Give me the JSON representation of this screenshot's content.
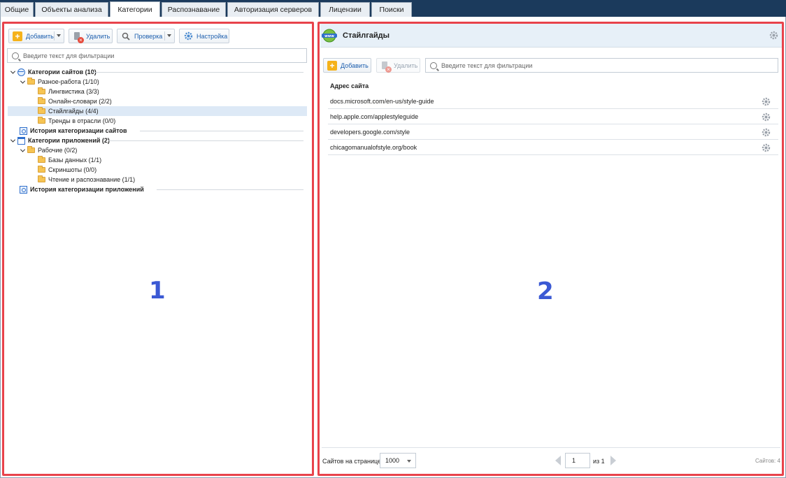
{
  "tabs": [
    {
      "label": "Общие",
      "active": false
    },
    {
      "label": "Объекты анализа",
      "active": false
    },
    {
      "label": "Категории",
      "active": true
    },
    {
      "label": "Распознавание",
      "active": false
    },
    {
      "label": "Авторизация серверов",
      "active": false
    },
    {
      "label": "Лицензии",
      "active": false
    },
    {
      "label": "Поиски",
      "active": false
    }
  ],
  "left_panel": {
    "toolbar": {
      "add": "Добавить",
      "delete": "Удалить",
      "check": "Проверка",
      "settings": "Настройка"
    },
    "filter_placeholder": "Введите текст для фильтрации",
    "tree": [
      {
        "label": "Категории сайтов (10)",
        "bold": true,
        "icon": "globe-icon"
      },
      {
        "label": "Разное-работа (1/10)",
        "bold": false,
        "icon": "folder-icon"
      },
      {
        "label": "Лингвистика (3/3)",
        "bold": false,
        "icon": "folder-icon"
      },
      {
        "label": "Онлайн-словари (2/2)",
        "bold": false,
        "icon": "folder-icon"
      },
      {
        "label": "Стайлгайды (4/4)",
        "bold": false,
        "icon": "folder-icon",
        "selected": true
      },
      {
        "label": "Тренды в отрасли (0/0)",
        "bold": false,
        "icon": "folder-icon"
      },
      {
        "label": "История категоризации сайтов",
        "bold": true,
        "icon": "history-icon"
      },
      {
        "label": "Категории приложений (2)",
        "bold": true,
        "icon": "app-icon"
      },
      {
        "label": "Рабочие (0/2)",
        "bold": false,
        "icon": "folder-icon"
      },
      {
        "label": "Базы данных (1/1)",
        "bold": false,
        "icon": "folder-icon"
      },
      {
        "label": "Скриншоты (0/0)",
        "bold": false,
        "icon": "folder-icon"
      },
      {
        "label": "Чтение и распознавание (1/1)",
        "bold": false,
        "icon": "folder-icon"
      },
      {
        "label": "История категоризации приложений",
        "bold": true,
        "icon": "history-icon"
      }
    ]
  },
  "right_panel": {
    "title": "Стайлгайды",
    "toolbar": {
      "add": "Добавить",
      "delete": "Удалить"
    },
    "filter_placeholder": "Введите текст для фильтрации",
    "column_header": "Адрес сайта",
    "urls": [
      "docs.microsoft.com/en-us/style-guide",
      "help.apple.com/applestyleguide",
      "developers.google.com/style",
      "chicagomanualofstyle.org/book"
    ],
    "footer": {
      "per_page_label": "Сайтов на странице",
      "per_page_value": "1000",
      "page_value": "1",
      "of_pages": "из 1",
      "total": "Сайтов: 4"
    }
  },
  "annotations": {
    "left": "1",
    "right": "2"
  },
  "colors": {
    "tabbar": "#1b3a5c",
    "accent_red": "#e8434b",
    "annotation_blue": "#3b59d4",
    "selected_row": "#dde9f6",
    "link_blue": "#1d5fae"
  }
}
